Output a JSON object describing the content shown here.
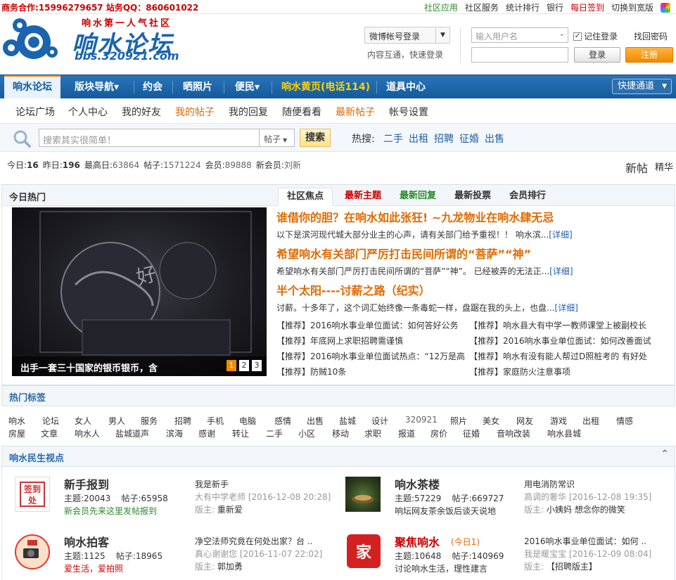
{
  "topbar": {
    "biz": "商务合作:15996279657   站务QQ：860601022",
    "links": [
      "社区应用",
      "社区服务",
      "统计排行",
      "银行",
      "每日签到",
      "切换到宽版"
    ]
  },
  "logo": {
    "slogan": "响水第一人气社区",
    "name": "响水论坛",
    "url": "bbs.320921.com"
  },
  "login": {
    "weibo_select": "微博帐号登录",
    "weibo_sub": "内容互通，快速登录",
    "username_placeholder": "输入用户名",
    "remember": "记住登录",
    "retrieve": "找回密码",
    "login_btn": "登录",
    "register_btn": "注册"
  },
  "nav": {
    "items": [
      "响水论坛",
      "版块导航▾",
      "约会",
      "晒照片",
      "便民▾",
      "响水黄页(电话114)",
      "道具中心"
    ],
    "quick": "快捷通道"
  },
  "subnav": [
    "论坛广场",
    "个人中心",
    "我的好友",
    "我的帖子",
    "我的回复",
    "随便看看",
    "最新帖子",
    "帐号设置"
  ],
  "search": {
    "placeholder": "搜索其实很简单！",
    "type": "帖子",
    "button": "搜索",
    "hot_label": "热搜:",
    "hot": [
      "二手",
      "出租",
      "招聘",
      "征婚",
      "出售"
    ]
  },
  "stats": {
    "today_l": "今日:",
    "today": "16",
    "yest_l": "昨日:",
    "yest": "196",
    "max_l": "最高日:",
    "max": "63864",
    "posts_l": "帖子:",
    "posts": "1571224",
    "members_l": "会员:",
    "members": "89888",
    "newmem_l": "新会员:",
    "newmem": "刘新",
    "newpost": "新帖",
    "digest": "精华"
  },
  "hot": {
    "title": "今日热门",
    "tabs": [
      "社区焦点",
      "最新主题",
      "最新回复",
      "最新投票",
      "会员排行"
    ],
    "slide_caption": "出手一套三十国家的银币银币，含",
    "slide_nums": [
      "1",
      "2",
      "3"
    ],
    "headlines": [
      {
        "title": "谁借你的胆？在响水如此张狂! ~九龙物业在响水肆无忌",
        "summary": "以下是滨河现代城大部分业主的心声，请有关部门给予重视！！      响水滨...[详细]"
      },
      {
        "title": "希望响水有关部门严厉打击民间所谓的“菩萨”“神”",
        "summary": "希望响水有关部门严厉打击民间所谓的“菩萨”“神”。 已经被弄的无法正...[详细]"
      },
      {
        "title": "半个太阳----讨薪之路（纪实）",
        "summary": "讨薪。十多年了，这个词汇始终像一条毒蛇一样，盘踞在我的头上，也盘...[详细]"
      }
    ],
    "recs": [
      "【推荐】2016响水事业单位面试：如何答好公务",
      "【推荐】响水县大有中学一教师课堂上被副校长",
      "【推荐】年底网上求职招聘需谨慎",
      "【推荐】2016响水事业单位面试：如何改善面试",
      "【推荐】2016响水事业单位面试热点：“12万是高",
      "【推荐】响水有没有能人帮过D照桩考的 有好处",
      "【推荐】防贼10条",
      "【推荐】家庭防火注意事项"
    ]
  },
  "tags": {
    "title": "热门标签",
    "row1": [
      "响水",
      "论坛",
      "女人",
      "男人",
      "服务",
      "招聘",
      "手机",
      "电脑",
      "感情",
      "出售",
      "盐城",
      "设计",
      "320921",
      "照片",
      "美女",
      "网友",
      "游戏",
      "出租",
      "情感"
    ],
    "row2": [
      "房屋",
      "文章",
      "响水人",
      "盐城道声",
      "滨海",
      "感谢",
      "转让",
      "二手",
      "小区",
      "移动",
      "求职",
      "报道",
      "房价",
      "征婚",
      "音响改装",
      "响水县城"
    ]
  },
  "forums": {
    "title": "响水民生视点",
    "items": [
      {
        "name": "新手报到",
        "topics_l": "主题:",
        "topics": "20043",
        "posts_l": "帖子:",
        "posts": "65958",
        "desc": "新会员先来这里发帖报到",
        "last": "我是新手",
        "last_by": "大有中学老师 [2016-12-08 20:28]",
        "mod_l": "版主:",
        "mod": "重新爱",
        "today": ""
      },
      {
        "name": "响水茶楼",
        "topics_l": "主题:",
        "topics": "57229",
        "posts_l": "帖子:",
        "posts": "669727",
        "desc": "响坛网友茶余饭后谈天说地",
        "last": "用电消防常识",
        "last_by": "高调的奢华 [2016-12-08 19:35]",
        "mod_l": "版主:",
        "mod": "小姨妈 想念你的微笑",
        "today": ""
      },
      {
        "name": "响水拍客",
        "topics_l": "主题:",
        "topics": "1125",
        "posts_l": "帖子:",
        "posts": "18965",
        "desc": "爱生活，爱拍照",
        "last": "净空法师究竟在何处出家？台 ..",
        "last_by": "真心谢谢您 [2016-11-07 22:02]",
        "mod_l": "版主:",
        "mod": "郭加勇",
        "today": ""
      },
      {
        "name": "聚焦响水",
        "topics_l": "主题:",
        "topics": "10648",
        "posts_l": "帖子:",
        "posts": "140969",
        "desc": "讨论响水生活，理性建言",
        "last": "2016响水事业单位面试：如何 ..",
        "last_by": "我是暖宝宝 [2016-12-09 08:04]",
        "mod_l": "版主:",
        "mod": "【招聘版主】",
        "today": "(今日1)"
      }
    ]
  },
  "colors": {
    "brand_blue": "#135b9c",
    "orange": "#e06a00",
    "red": "#c00",
    "green": "#2a8a2a"
  }
}
